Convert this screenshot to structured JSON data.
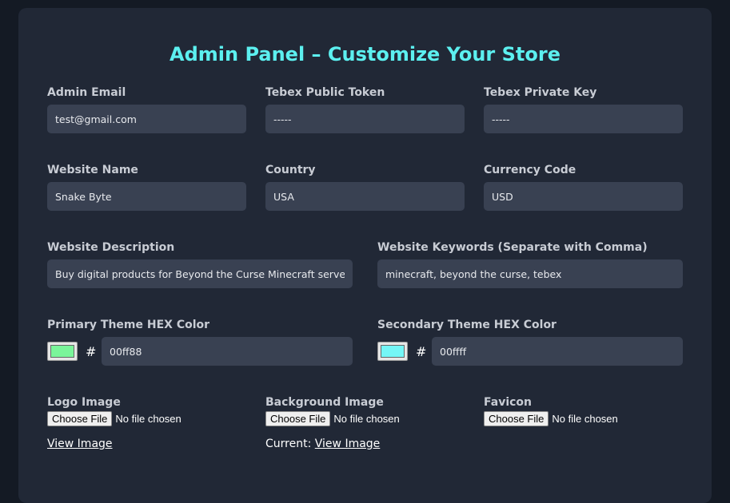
{
  "title": "Admin Panel – Customize Your Store",
  "fields": {
    "admin_email": {
      "label": "Admin Email",
      "value": "test@gmail.com"
    },
    "public_token": {
      "label": "Tebex Public Token",
      "value": "-----"
    },
    "private_key": {
      "label": "Tebex Private Key",
      "value": "-----"
    },
    "website_name": {
      "label": "Website Name",
      "value": "Snake Byte"
    },
    "country": {
      "label": "Country",
      "value": "USA"
    },
    "currency": {
      "label": "Currency Code",
      "value": "USD"
    },
    "description": {
      "label": "Website Description",
      "value": "Buy digital products for Beyond the Curse Minecraft server."
    },
    "keywords": {
      "label": "Website Keywords (Separate with Comma)",
      "value": "minecraft, beyond the curse, tebex"
    }
  },
  "colors": {
    "primary": {
      "label": "Primary Theme HEX Color",
      "hash": "#",
      "value": "00ff88",
      "swatch": "#7af59a"
    },
    "secondary": {
      "label": "Secondary Theme HEX Color",
      "hash": "#",
      "value": "00ffff",
      "swatch": "#74f6f6"
    }
  },
  "uploads": {
    "logo": {
      "label": "Logo Image",
      "button": "Choose File",
      "status": "No file chosen",
      "link": "View Image"
    },
    "background": {
      "label": "Background Image",
      "button": "Choose File",
      "status": "No file chosen",
      "prefix": "Current:",
      "link": "View Image"
    },
    "favicon": {
      "label": "Favicon",
      "button": "Choose File",
      "status": "No file chosen"
    }
  }
}
